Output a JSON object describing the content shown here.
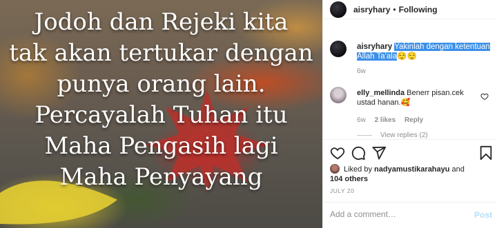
{
  "image": {
    "quote_lines": [
      "Jodoh dan Rejeki kita",
      "tak akan tertukar dengan",
      "punya orang lain.",
      "Percayalah Tuhan itu",
      "Maha Pengasih lagi",
      "Maha Penyayang"
    ]
  },
  "header": {
    "username": "aisryhary",
    "separator": "•",
    "follow_status": "Following"
  },
  "caption": {
    "username": "aisryhary",
    "text_highlighted_1": "Yakinlah dengan ketentuan",
    "text_highlighted_2": "Allah Ta'ala",
    "emojis": "😌😌",
    "age": "6w"
  },
  "comment": {
    "username": "elly_mellinda",
    "text": "Benerr pisan.cek ustad hanan.",
    "emoji": "🥰",
    "age": "6w",
    "likes": "2 likes",
    "reply": "Reply",
    "view_replies": "View replies (2)"
  },
  "icons": {
    "like": "heart-icon",
    "comment": "comment-icon",
    "share": "share-icon",
    "save": "bookmark-icon"
  },
  "likes": {
    "prefix": "Liked by",
    "user": "nadyamustikarahayu",
    "and": "and",
    "others": "104 others"
  },
  "date": "JULY 20",
  "add_comment": {
    "placeholder": "Add a comment…",
    "post_label": "Post"
  },
  "colors": {
    "highlight": "#3b8fe8",
    "muted": "#8e8e8e",
    "post_disabled": "#b2dffc"
  }
}
